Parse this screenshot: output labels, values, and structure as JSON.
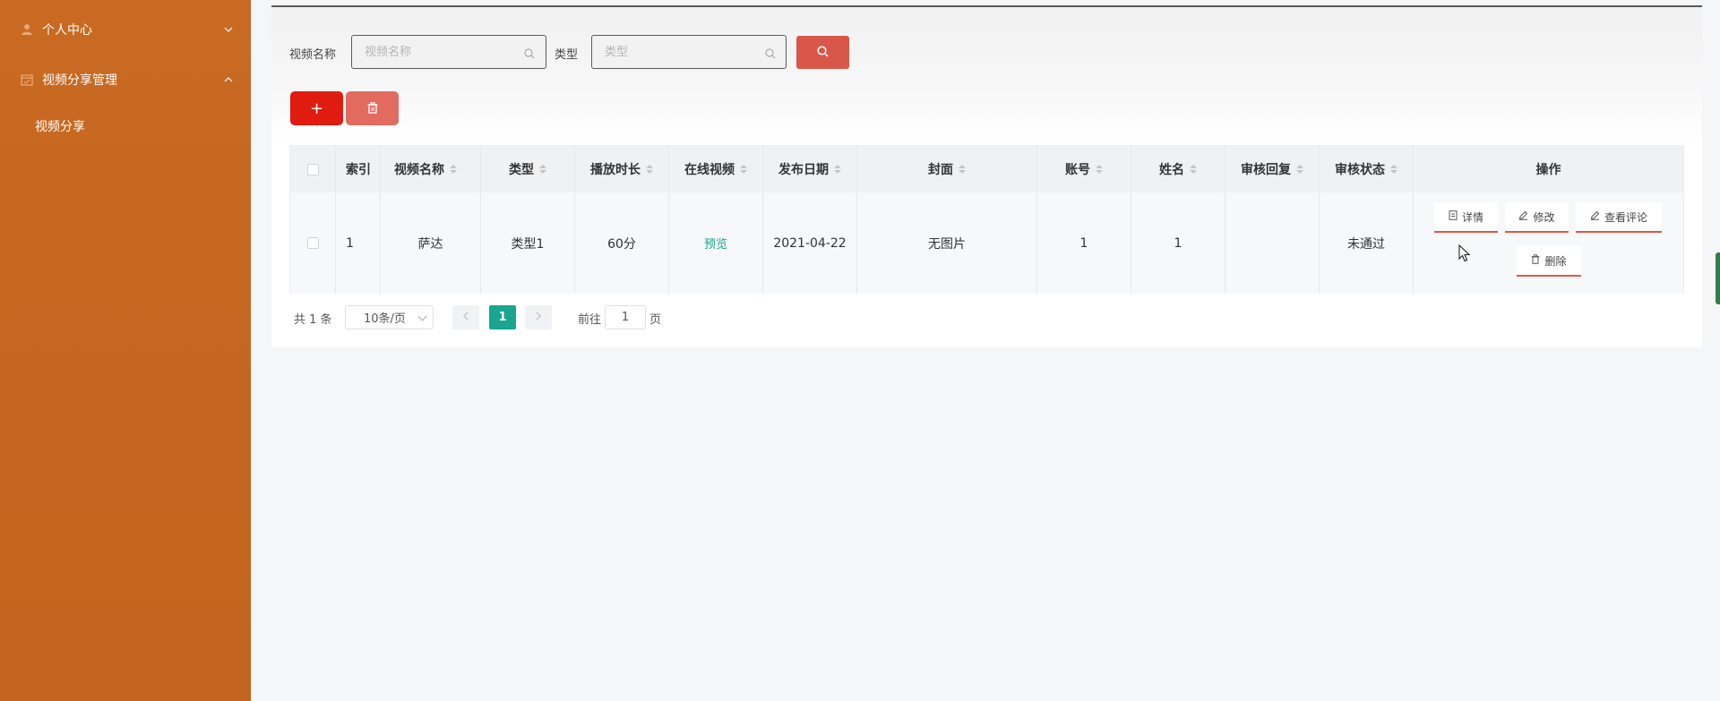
{
  "sidebar": {
    "items": [
      {
        "label": "个人中心",
        "icon": "user-icon",
        "chevron": "down"
      },
      {
        "label": "视频分享管理",
        "icon": "calendar-icon",
        "chevron": "up"
      }
    ],
    "subitems": [
      {
        "label": "视频分享"
      }
    ]
  },
  "search": {
    "name_label": "视频名称",
    "name_placeholder": "视频名称",
    "type_label": "类型",
    "type_placeholder": "类型"
  },
  "toolbar": {
    "add_label": "+"
  },
  "table": {
    "headers": [
      "索引",
      "视频名称",
      "类型",
      "播放时长",
      "在线视频",
      "发布日期",
      "封面",
      "账号",
      "姓名",
      "审核回复",
      "审核状态",
      "操作"
    ],
    "rows": [
      {
        "index": "1",
        "name": "萨达",
        "type": "类型1",
        "duration": "60分",
        "online_video": "预览",
        "date": "2021-04-22",
        "cover": "无图片",
        "account": "1",
        "realname": "1",
        "review_reply": "",
        "review_status": "未通过",
        "actions": [
          "详情",
          "修改",
          "查看评论",
          "删除"
        ]
      }
    ]
  },
  "pagination": {
    "total_text": "共 1 条",
    "page_size": "10条/页",
    "current_page": "1",
    "goto_label": "前往",
    "goto_value": "1",
    "page_suffix": "页"
  },
  "colors": {
    "sidebar": "#c4661f",
    "search_button": "#d9574a",
    "add_button": "#e01b0f",
    "delete_button": "#e06b5e",
    "accent_green": "#19a58f"
  }
}
